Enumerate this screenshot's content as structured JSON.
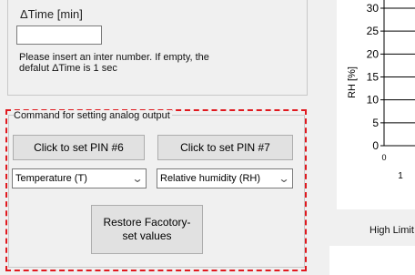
{
  "top_panel": {
    "dtime_label": "ΔTime [min]",
    "dtime_value": "",
    "help_text": "Please insert an inter number. If empty, the defalut ΔTime is 1 sec"
  },
  "analog_group": {
    "title": "Command for setting analog output",
    "pin6_button": "Click to set PIN #6",
    "pin7_button": "Click to set PIN #7",
    "select_left": "Temperature (T)",
    "select_right": "Relative humidity (RH)",
    "restore_button": "Restore Facotory-set values"
  },
  "chart_data": {
    "type": "line",
    "ylabel": "RH [%]",
    "y_ticks": [
      "0",
      "5",
      "10",
      "15",
      "20",
      "25",
      "30"
    ],
    "x_ticks": [
      "0",
      "1"
    ],
    "ylim": [
      0,
      30
    ],
    "grid": false
  },
  "right_panel": {
    "high_limit_label": "High Limit"
  },
  "colors": {
    "highlight": "#e0191f",
    "window_bg": "#f0f0f0",
    "button_bg": "#e1e1e1"
  }
}
